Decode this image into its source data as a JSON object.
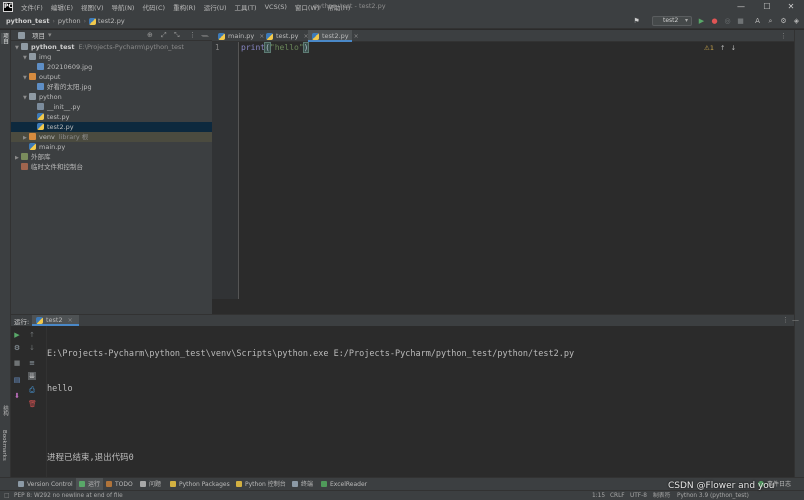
{
  "titlebar": {
    "menu": [
      "文件(F)",
      "编辑(E)",
      "视图(V)",
      "导航(N)",
      "代码(C)",
      "重构(R)",
      "运行(U)",
      "工具(T)",
      "VCS(S)",
      "窗口(W)",
      "帮助(H)"
    ],
    "window_title": "python_test - test2.py",
    "minimize": "—",
    "maximize": "☐",
    "close": "✕"
  },
  "navbar": {
    "project": "python_test",
    "folder": "python",
    "file": "test2.py",
    "run_config": "test2"
  },
  "left_strip": {
    "project_label": "项目",
    "structure_label": "结构",
    "bookmarks_label": "Bookmarks"
  },
  "project_panel": {
    "title": "项目",
    "tree": [
      {
        "label": "python_test",
        "extra": "E:\\Projects-Pycharm\\python_test"
      },
      {
        "label": "img",
        "extra": ""
      },
      {
        "label": "20210609.jpg",
        "extra": ""
      },
      {
        "label": "output",
        "extra": ""
      },
      {
        "label": "好看的太阳.jpg",
        "extra": ""
      },
      {
        "label": "python",
        "extra": ""
      },
      {
        "label": "__init__.py",
        "extra": ""
      },
      {
        "label": "test.py",
        "extra": ""
      },
      {
        "label": "test2.py",
        "extra": ""
      },
      {
        "label": "venv",
        "extra": "library 根"
      },
      {
        "label": "main.py",
        "extra": ""
      },
      {
        "label": "外部库",
        "extra": ""
      },
      {
        "label": "临时文件和控制台",
        "extra": ""
      }
    ]
  },
  "editor": {
    "tabs": [
      {
        "label": "main.py"
      },
      {
        "label": "test.py"
      },
      {
        "label": "test2.py"
      }
    ],
    "line_number": "1",
    "code_fn": "print",
    "code_open": "(",
    "code_str": "\"hello\"",
    "code_close": ")",
    "inspection": "⚠1"
  },
  "run_panel": {
    "title": "运行:",
    "tab": "test2",
    "console": [
      "E:\\Projects-Pycharm\\python_test\\venv\\Scripts\\python.exe E:/Projects-Pycharm/python_test/python/test2.py",
      "hello",
      "",
      "进程已结束,退出代码0"
    ]
  },
  "tool_bar": {
    "items": [
      "Version Control",
      "运行",
      "TODO",
      "问题",
      "Python Packages",
      "Python 控制台",
      "终端",
      "ExcelReader"
    ],
    "event_log": "事件日志"
  },
  "status_bar": {
    "message": "PEP 8: W292 no newline at end of file",
    "position": "1:15",
    "line_sep": "CRLF",
    "encoding": "UTF-8",
    "indent": "制表符",
    "interpreter": "Python 3.9 (python_test)"
  },
  "watermark": "CSDN @Flower and you",
  "colors": {
    "background": "#2b2b2b",
    "panel": "#3c3f41",
    "accent": "#4a88c7",
    "string": "#6a8759",
    "selection": "#0d293e"
  }
}
